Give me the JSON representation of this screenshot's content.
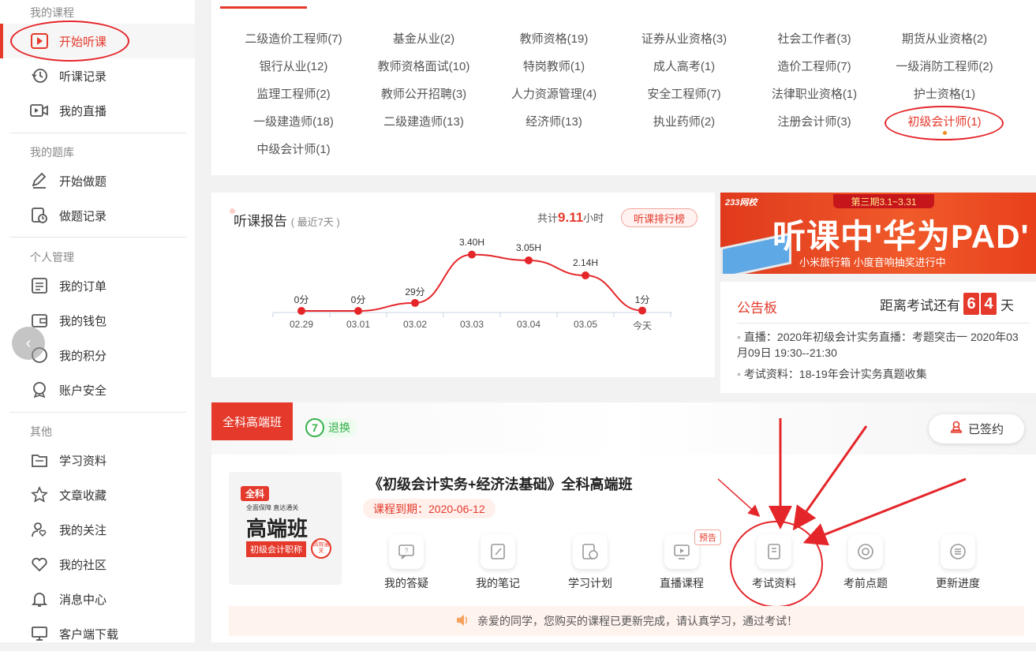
{
  "sidebar": {
    "sec1": "我的课程",
    "sec2": "我的题库",
    "sec3": "个人管理",
    "sec4": "其他",
    "items": {
      "start_listen": "开始听课",
      "listen_record": "听课记录",
      "my_live": "我的直播",
      "start_practice": "开始做题",
      "practice_record": "做题记录",
      "my_orders": "我的订单",
      "my_wallet": "我的钱包",
      "my_points": "我的积分",
      "account_security": "账户安全",
      "study_materials": "学习资料",
      "article_fav": "文章收藏",
      "my_follow": "我的关注",
      "my_community": "我的社区",
      "message_center": "消息中心",
      "client_download": "客户端下载"
    }
  },
  "categories": [
    "二级造价工程师(7)",
    "基金从业(2)",
    "教师资格(19)",
    "证券从业资格(3)",
    "社会工作者(3)",
    "期货从业资格(2)",
    "银行从业(12)",
    "教师资格面试(10)",
    "特岗教师(1)",
    "成人高考(1)",
    "造价工程师(7)",
    "一级消防工程师(2)",
    "监理工程师(2)",
    "教师公开招聘(3)",
    "人力资源管理(4)",
    "安全工程师(7)",
    "法律职业资格(1)",
    "护士资格(1)",
    "一级建造师(18)",
    "二级建造师(13)",
    "经济师(13)",
    "执业药师(2)",
    "注册会计师(3)",
    "初级会计师(1)",
    "中级会计师(1)"
  ],
  "report": {
    "title": "听课报告",
    "subtitle": "( 最近7天 )",
    "total_prefix": "共计",
    "total_value": "9.11",
    "total_unit": "小时",
    "rank_label": "听课排行榜"
  },
  "chart_data": {
    "type": "line",
    "x": [
      "02.29",
      "03.01",
      "03.02",
      "03.03",
      "03.04",
      "03.05",
      "今天"
    ],
    "point_labels": [
      "0分",
      "0分",
      "29分",
      "3.40H",
      "3.05H",
      "2.14H",
      "1分"
    ],
    "values_hours": [
      0,
      0,
      0.48,
      3.4,
      3.05,
      2.14,
      0.02
    ],
    "color": "#e4262a"
  },
  "banner": {
    "brand": "233网校",
    "period": "第三期3.1~3.31",
    "headline": "听课中'华为PAD'",
    "sub": "小米旅行箱 小度音响抽奖进行中"
  },
  "notice": {
    "title": "公告板",
    "countdown_prefix": "距离考试还有",
    "d1": "6",
    "d2": "4",
    "countdown_unit": "天",
    "items": [
      "直播：2020年初级会计实务直播：考题突击一 2020年03月09日 19:30--21:30",
      "考试资料：18-19年会计实务真题收集"
    ]
  },
  "course": {
    "tag": "全科高端班",
    "refund_badge": "7",
    "refund_label": "退换",
    "signed_label": "已签约",
    "thumb_tag": "全科",
    "thumb_slogan": "全面保障  直达通关",
    "thumb_title": "高端班",
    "thumb_sub": "初级会计职称",
    "thumb_seal": "高效通关",
    "title": "《初级会计实务+经济法基础》全科高端班",
    "expire": "课程到期：2020-06-12",
    "tools": [
      "我的答疑",
      "我的笔记",
      "学习计划",
      "直播课程",
      "考试资料",
      "考前点题",
      "更新进度"
    ],
    "preview_badge": "预告",
    "footer_msg": "亲爱的同学，您购买的课程已更新完成，请认真学习，通过考试！"
  },
  "accent_color": "#e4392b"
}
